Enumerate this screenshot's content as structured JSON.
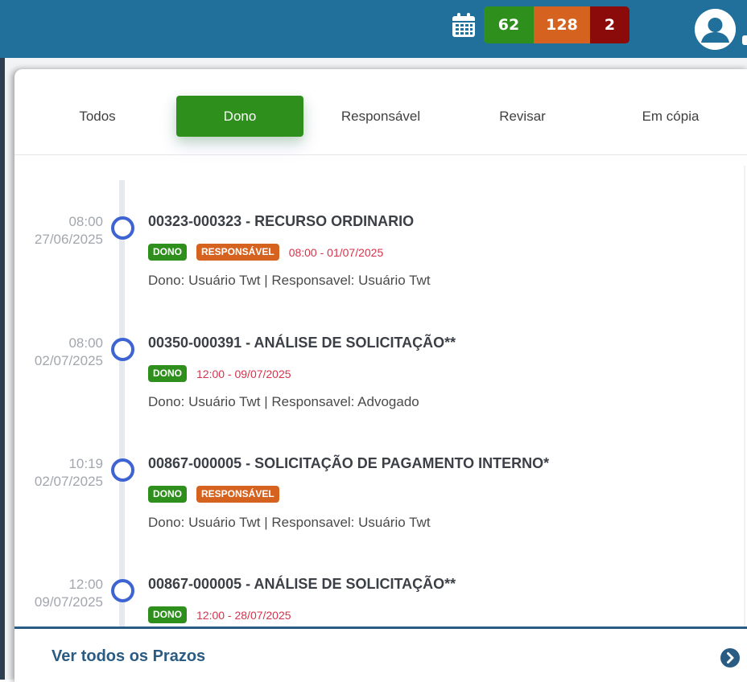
{
  "header": {
    "calendar_icon": "calendar-icon",
    "counts": [
      {
        "value": "62",
        "color": "#2f8f1d"
      },
      {
        "value": "128",
        "color": "#d6621f"
      },
      {
        "value": "2",
        "color": "#8b0b0b"
      }
    ],
    "avatar_icon": "user-avatar-icon"
  },
  "tabs": [
    {
      "label": "Todos"
    },
    {
      "label": "Dono"
    },
    {
      "label": "Responsável"
    },
    {
      "label": "Revisar"
    },
    {
      "label": "Em cópia"
    }
  ],
  "entries": [
    {
      "time": "08:00",
      "date": "27/06/2025",
      "title": "00323-000323 - RECURSO ORDINARIO",
      "badges": [
        "DONO",
        "RESPONSÁVEL"
      ],
      "due": "08:00 - 01/07/2025",
      "sub": "Dono: Usuário Twt | Responsavel: Usuário Twt"
    },
    {
      "time": "08:00",
      "date": "02/07/2025",
      "title": "00350-000391 - ANÁLISE DE SOLICITAÇÃO**",
      "badges": [
        "DONO"
      ],
      "due": "12:00 - 09/07/2025",
      "sub": "Dono: Usuário Twt | Responsavel: Advogado"
    },
    {
      "time": "10:19",
      "date": "02/07/2025",
      "title": "00867-000005 - SOLICITAÇÃO DE PAGAMENTO INTERNO*",
      "badges": [
        "DONO",
        "RESPONSÁVEL"
      ],
      "due": "",
      "sub": "Dono: Usuário Twt | Responsavel: Usuário Twt"
    },
    {
      "time": "12:00",
      "date": "09/07/2025",
      "title": "00867-000005 - ANÁLISE DE SOLICITAÇÃO**",
      "badges": [
        "DONO"
      ],
      "due": "12:00 - 28/07/2025",
      "sub": ""
    }
  ],
  "footer": {
    "link": "Ver todos os Prazos",
    "icon": "chevron-right-circle-icon"
  }
}
